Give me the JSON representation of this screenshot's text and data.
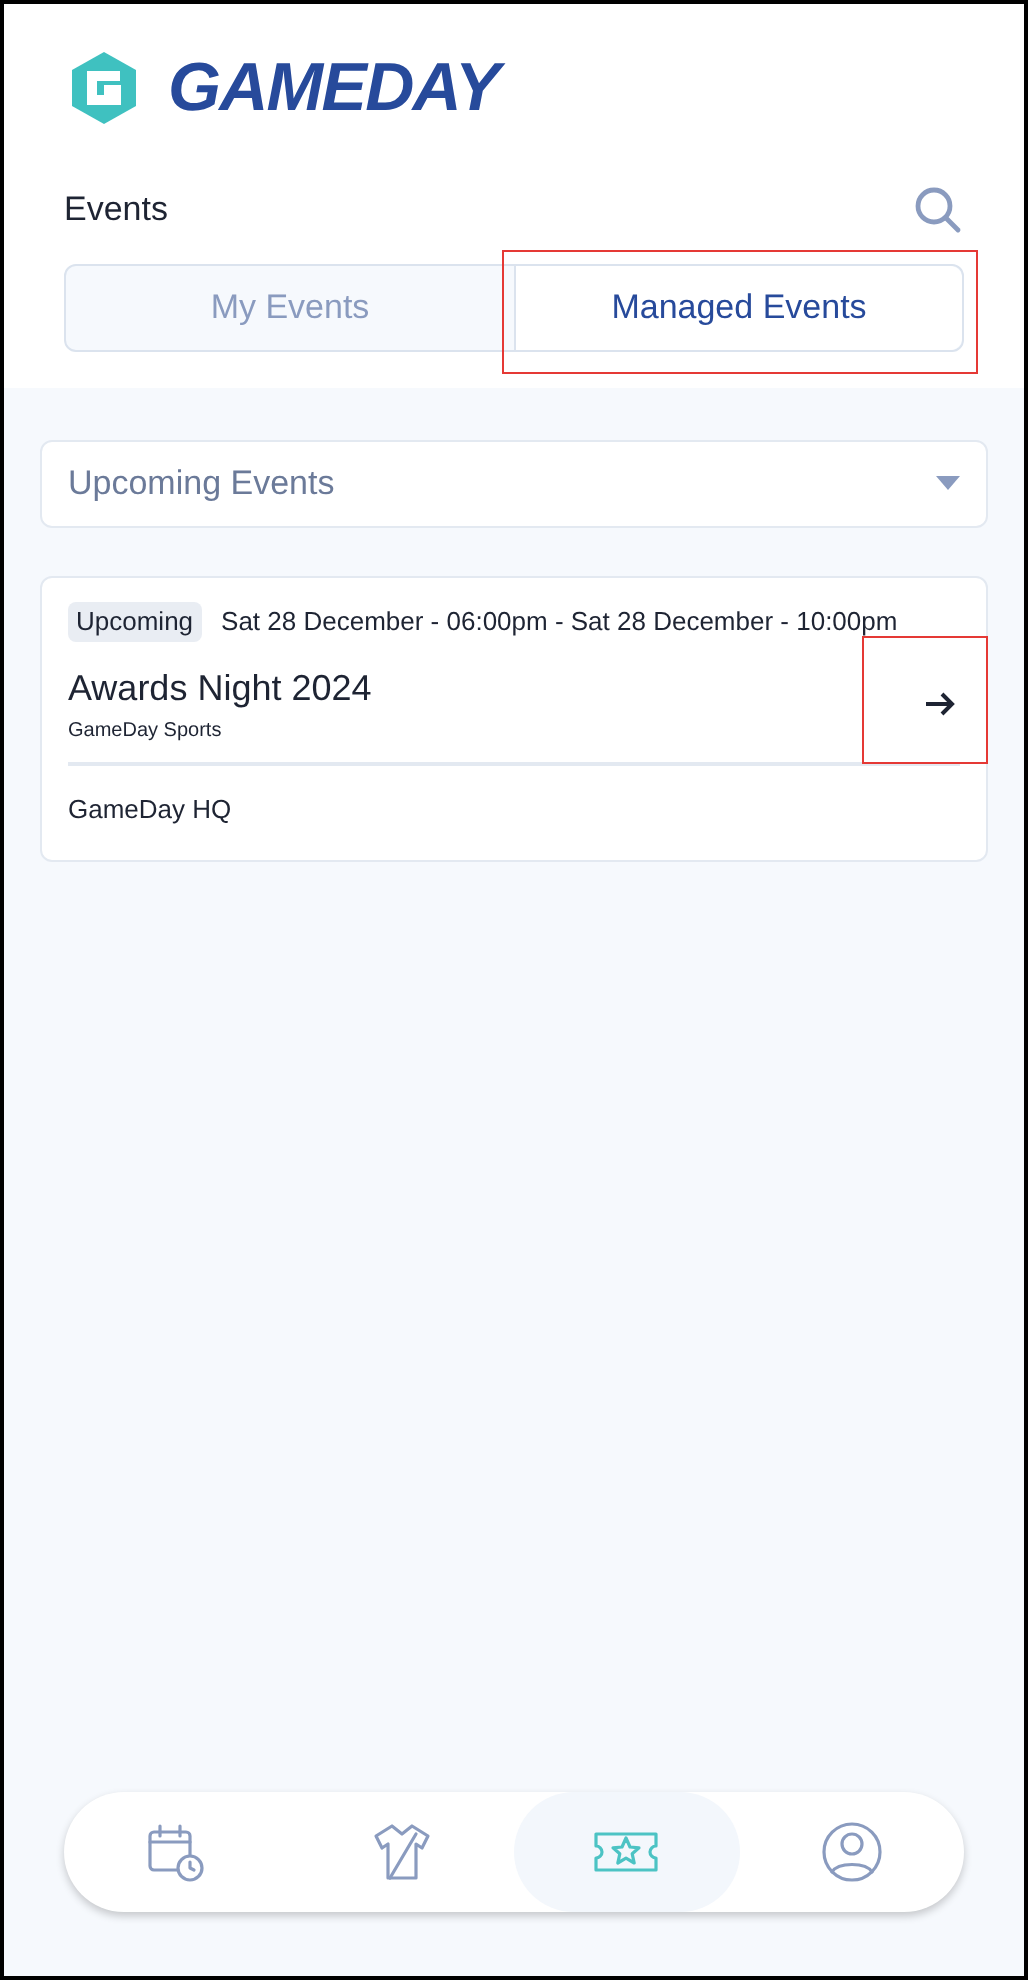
{
  "logo": {
    "text": "GAMEDAY"
  },
  "header": {
    "title": "Events"
  },
  "tabs": [
    {
      "label": "My Events",
      "selected": false,
      "highlighted": false
    },
    {
      "label": "Managed Events",
      "selected": true,
      "highlighted": true
    }
  ],
  "filter": {
    "value": "Upcoming Events"
  },
  "events": [
    {
      "status": "Upcoming",
      "dates": "Sat 28 December - 06:00pm - Sat 28 December - 10:00pm",
      "title": "Awards Night 2024",
      "organiser": "GameDay Sports",
      "venue": "GameDay HQ",
      "arrow_highlighted": true
    }
  ],
  "nav": [
    {
      "kind": "calendar",
      "selected": false
    },
    {
      "kind": "shirt",
      "selected": false
    },
    {
      "kind": "ticket",
      "selected": true
    },
    {
      "kind": "profile",
      "selected": false
    }
  ]
}
